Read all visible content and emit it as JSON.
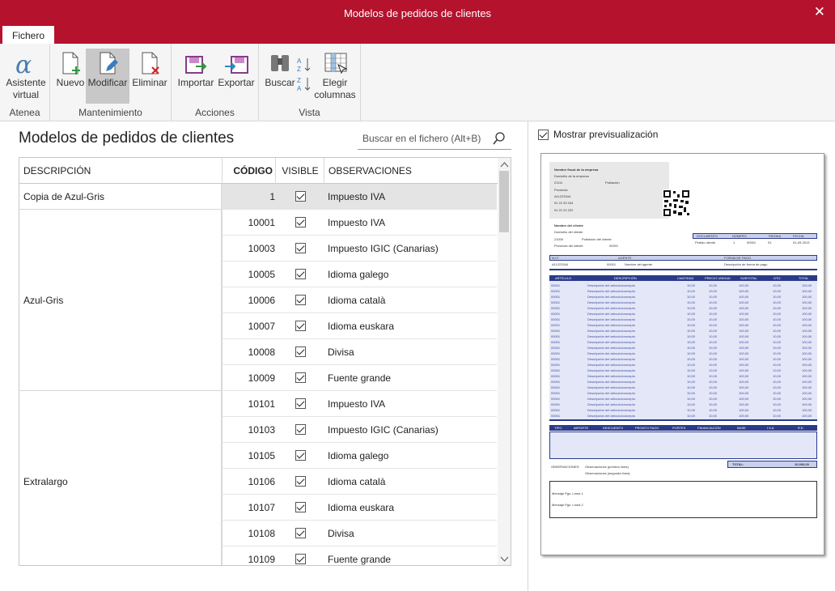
{
  "window": {
    "title": "Modelos de pedidos de clientes"
  },
  "tab": {
    "label": "Fichero"
  },
  "ribbon": {
    "groups": [
      {
        "label": "Atenea"
      },
      {
        "label": "Mantenimiento"
      },
      {
        "label": "Acciones"
      },
      {
        "label": "Vista"
      }
    ],
    "assistant": "Asistente virtual",
    "new": "Nuevo",
    "modify": "Modificar",
    "delete": "Eliminar",
    "import": "Importar",
    "export": "Exportar",
    "search": "Buscar",
    "choose_columns": "Elegir columnas"
  },
  "main": {
    "heading": "Modelos de pedidos de clientes",
    "search_placeholder": "Buscar en el fichero (Alt+B)"
  },
  "table": {
    "headers": {
      "description": "DESCRIPCIÓN",
      "code": "CÓDIGO",
      "visible": "VISIBLE",
      "observations": "OBSERVACIONES"
    },
    "groups": [
      {
        "description": "Copia de Azul-Gris"
      },
      {
        "description": "Azul-Gris"
      },
      {
        "description": "Extralargo"
      }
    ],
    "rows": [
      {
        "code": "1",
        "obs": "Impuesto IVA"
      },
      {
        "code": "10001",
        "obs": "Impuesto IVA"
      },
      {
        "code": "10003",
        "obs": "Impuesto IGIC (Canarias)"
      },
      {
        "code": "10005",
        "obs": "Idioma galego"
      },
      {
        "code": "10006",
        "obs": "Idioma català"
      },
      {
        "code": "10007",
        "obs": "Idioma euskara"
      },
      {
        "code": "10008",
        "obs": "Divisa"
      },
      {
        "code": "10009",
        "obs": "Fuente grande"
      },
      {
        "code": "10101",
        "obs": "Impuesto IVA"
      },
      {
        "code": "10103",
        "obs": "Impuesto IGIC (Canarias)"
      },
      {
        "code": "10105",
        "obs": "Idioma galego"
      },
      {
        "code": "10106",
        "obs": "Idioma català"
      },
      {
        "code": "10107",
        "obs": "Idioma euskara"
      },
      {
        "code": "10108",
        "obs": "Divisa"
      },
      {
        "code": "10109",
        "obs": "Fuente grande"
      }
    ]
  },
  "preview": {
    "toggle_label": "Mostrar previsualización",
    "company": [
      "Nombre fiscal de la empresa",
      "Domicilio de la empresa",
      "21111",
      "Población",
      "Provincia",
      "A11223344",
      "91 22 33 444",
      "91 22 22 222"
    ],
    "client": [
      "Nombre del cliente",
      "Domicilio del cliente",
      "21000",
      "Población del cliente",
      "Provincia del cliente",
      "00001"
    ],
    "doc_headers": [
      "DOCUMENTO",
      "NÚMERO",
      "PÁGINA",
      "FECHA"
    ],
    "doc_values": [
      "Pedido cliente",
      "1",
      "00001",
      "01",
      "01-09-2013"
    ],
    "nif_headers": [
      "N.I.F.",
      "AGENTE",
      "FORMA DE PAGO"
    ],
    "nif_values": [
      "A11223344",
      "00001",
      "Nombre del agente",
      "Descripción de forma de pago"
    ],
    "line_headers": [
      "ARTÍCULO",
      "DESCRIPCIÓN",
      "CANTIDAD",
      "PRECIO UNIDAD",
      "SUBTOTAL",
      "DTO.",
      "TOTAL"
    ],
    "line_values": [
      "00001",
      "Descripción del artículo/concepto",
      "10,00",
      "10,00",
      "100,00",
      "10,00",
      "100,00"
    ],
    "total_headers": [
      "TIPO",
      "IMPORTE",
      "DESCUENTO",
      "PRONTO PAGO",
      "PORTES",
      "FINANCIACIÓN",
      "BASE",
      "I.V.A.",
      "R.E."
    ],
    "total_label": "TOTAL:",
    "total_value": "10.000,00",
    "obs_label": "OBSERVACIONES:",
    "obs_lines": [
      "Observaciones (primera línea)",
      "Observaciones (segunda línea)"
    ],
    "footer_lines": [
      "Mensaje Pgs. Línea 1",
      "Mensaje Pgs. Línea 2"
    ]
  },
  "colors": {
    "accent": "#b5122d",
    "doc_blue": "#2a3a8a"
  }
}
